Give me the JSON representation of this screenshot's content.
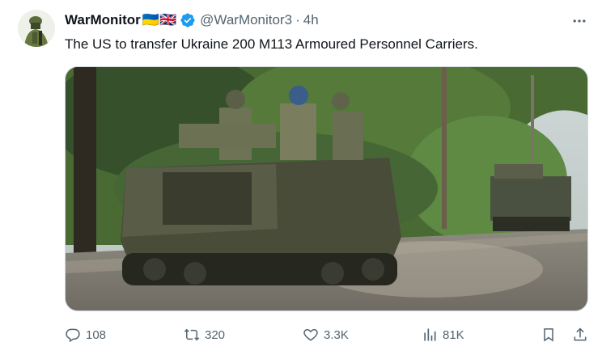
{
  "tweet": {
    "display_name": "WarMonitor",
    "flags": "🇺🇦🇬🇧",
    "handle": "@WarMonitor3",
    "separator": "·",
    "time": "4h",
    "text": "The US to transfer Ukraine 200 M113 Armoured Personnel Carriers."
  },
  "stats": {
    "replies": "108",
    "reposts": "320",
    "likes": "3.3K",
    "views": "81K"
  },
  "colors": {
    "verified": "#1d9bf0",
    "muted": "#536471"
  },
  "icons": {
    "reply": "reply-icon",
    "repost": "repost-icon",
    "like": "heart-icon",
    "views": "views-icon",
    "bookmark": "bookmark-icon",
    "share": "share-icon",
    "more": "more-icon",
    "verified": "verified-badge-icon"
  }
}
